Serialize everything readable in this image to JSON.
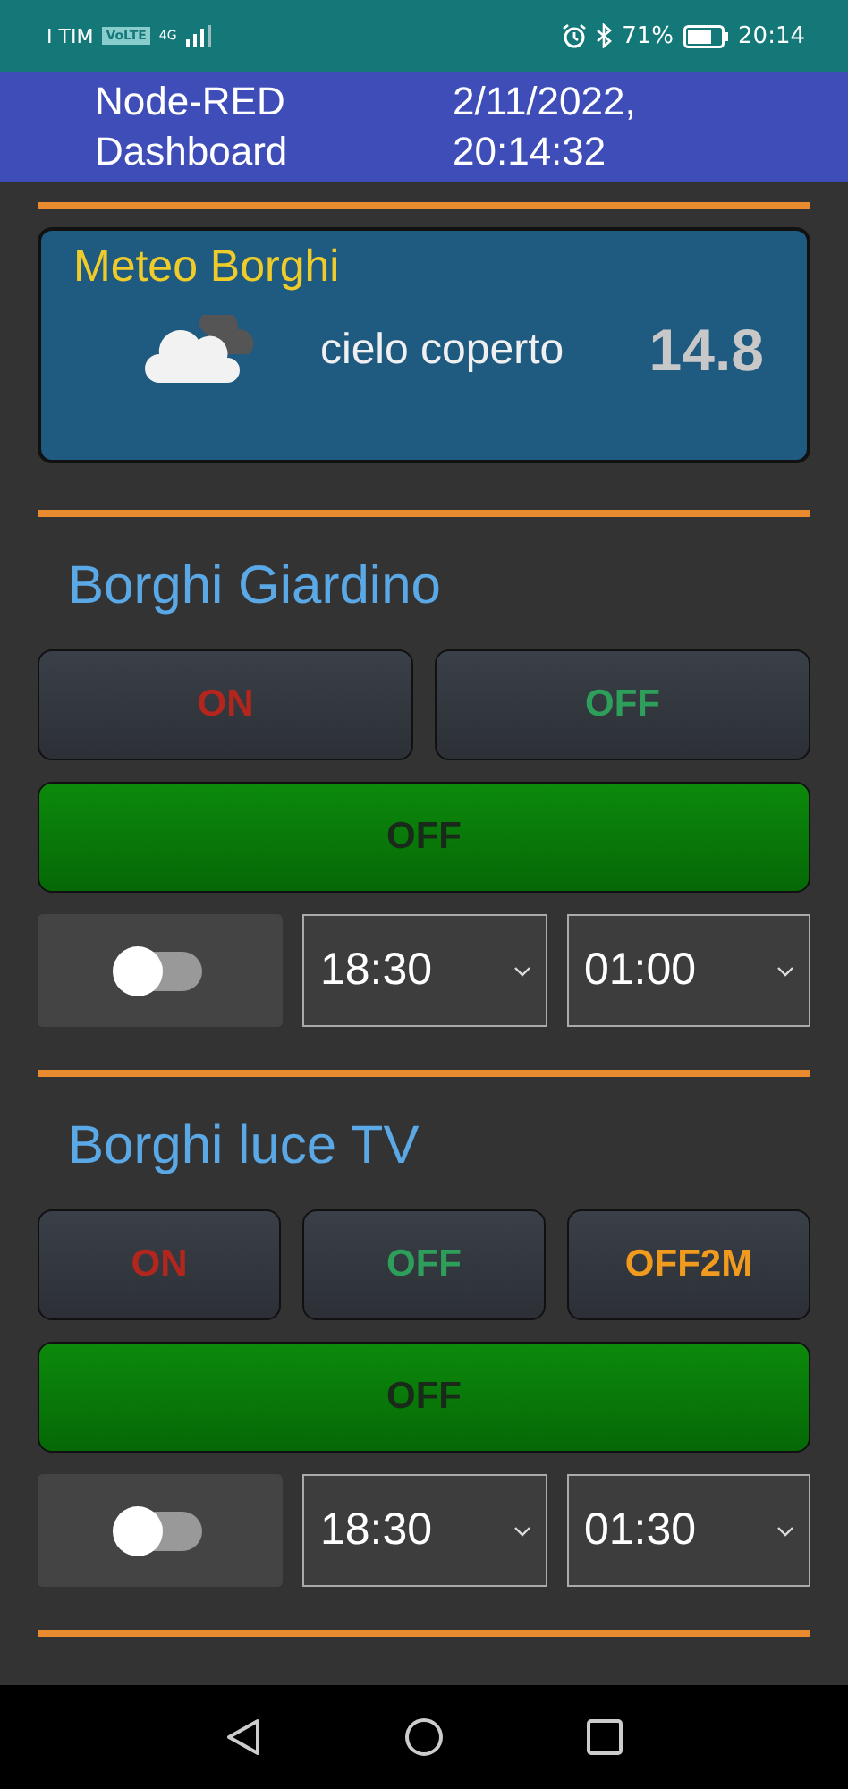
{
  "status_bar": {
    "carrier": "I TIM",
    "volte": "VoLTE",
    "network": "4G",
    "battery": "71%",
    "time": "20:14"
  },
  "header": {
    "title": "Node-RED Dashboard",
    "datetime": "2/11/2022, 20:14:32"
  },
  "sections": [
    {
      "kind": "weather",
      "title": "Meteo Borghi",
      "condition": "cielo coperto",
      "temperature": "14.8"
    },
    {
      "kind": "control",
      "title": "Borghi Giardino",
      "buttons": [
        {
          "label": "ON",
          "color": "#b3261e"
        },
        {
          "label": "OFF",
          "color": "#2e9e5b"
        }
      ],
      "status": "OFF",
      "switch_on": false,
      "selects": [
        "18:30",
        "01:00"
      ]
    },
    {
      "kind": "control",
      "title": "Borghi luce TV",
      "buttons": [
        {
          "label": "ON",
          "color": "#b3261e"
        },
        {
          "label": "OFF",
          "color": "#2e9e5b"
        },
        {
          "label": "OFF2M",
          "color": "#f09a1e"
        }
      ],
      "status": "OFF",
      "switch_on": false,
      "selects": [
        "18:30",
        "01:30"
      ]
    }
  ]
}
